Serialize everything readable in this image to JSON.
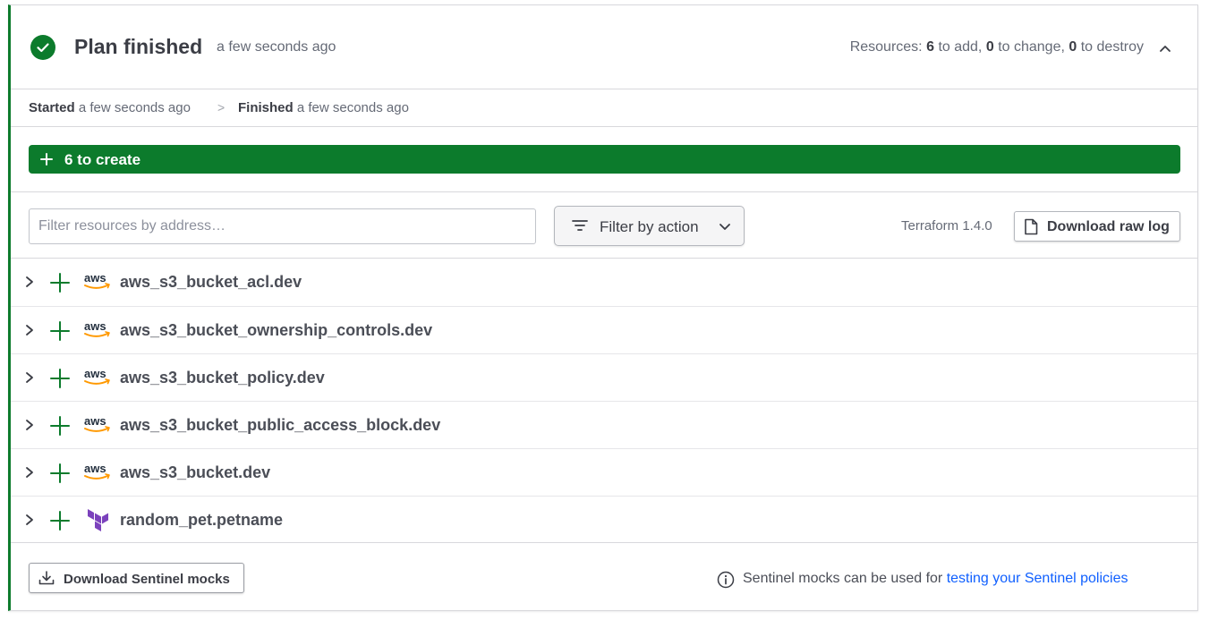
{
  "header": {
    "title": "Plan finished",
    "time": "a few seconds ago",
    "resources": {
      "prefix": "Resources:",
      "add_count": "6",
      "add_label": "to add,",
      "change_count": "0",
      "change_label": "to change,",
      "destroy_count": "0",
      "destroy_label": "to destroy"
    }
  },
  "timeline": {
    "started_label": "Started",
    "started_time": "a few seconds ago",
    "separator": ">",
    "finished_label": "Finished",
    "finished_time": "a few seconds ago"
  },
  "create_bar": {
    "label": "6 to create"
  },
  "toolbar": {
    "filter_placeholder": "Filter resources by address…",
    "filter_value": "",
    "filter_action_label": "Filter by action",
    "terraform_version": "Terraform 1.4.0",
    "download_raw_log_label": "Download raw log"
  },
  "resources": [
    {
      "name": "aws_s3_bucket_acl.dev",
      "provider": "aws",
      "action": "create"
    },
    {
      "name": "aws_s3_bucket_ownership_controls.dev",
      "provider": "aws",
      "action": "create"
    },
    {
      "name": "aws_s3_bucket_policy.dev",
      "provider": "aws",
      "action": "create"
    },
    {
      "name": "aws_s3_bucket_public_access_block.dev",
      "provider": "aws",
      "action": "create"
    },
    {
      "name": "aws_s3_bucket.dev",
      "provider": "aws",
      "action": "create"
    },
    {
      "name": "random_pet.petname",
      "provider": "terraform",
      "action": "create"
    }
  ],
  "footer": {
    "download_sentinel_label": "Download Sentinel mocks",
    "note_text": "Sentinel mocks can be used for",
    "note_link": "testing your Sentinel policies"
  },
  "colors": {
    "success_green": "#0c7b2c",
    "link_blue": "#1060ff",
    "aws_orange": "#ff9900",
    "terraform_purple": "#7b42bc"
  }
}
